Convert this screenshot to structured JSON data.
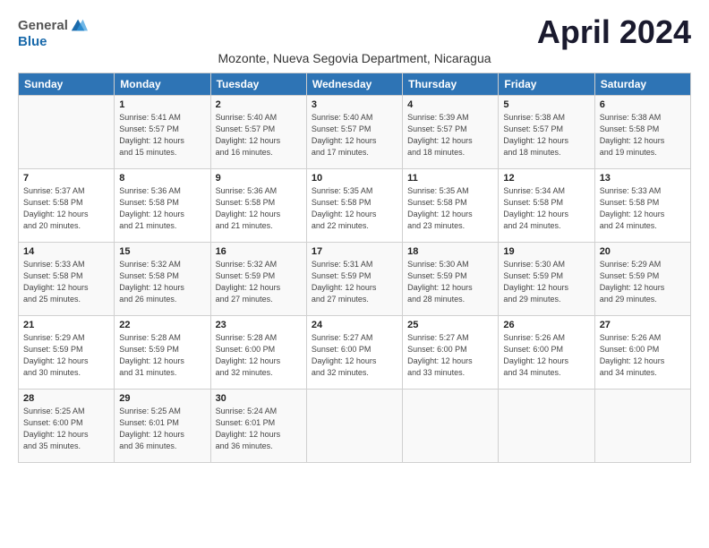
{
  "logo": {
    "general": "General",
    "blue": "Blue"
  },
  "title": "April 2024",
  "subtitle": "Mozonte, Nueva Segovia Department, Nicaragua",
  "weekdays": [
    "Sunday",
    "Monday",
    "Tuesday",
    "Wednesday",
    "Thursday",
    "Friday",
    "Saturday"
  ],
  "weeks": [
    [
      {
        "day": "",
        "info": ""
      },
      {
        "day": "1",
        "info": "Sunrise: 5:41 AM\nSunset: 5:57 PM\nDaylight: 12 hours\nand 15 minutes."
      },
      {
        "day": "2",
        "info": "Sunrise: 5:40 AM\nSunset: 5:57 PM\nDaylight: 12 hours\nand 16 minutes."
      },
      {
        "day": "3",
        "info": "Sunrise: 5:40 AM\nSunset: 5:57 PM\nDaylight: 12 hours\nand 17 minutes."
      },
      {
        "day": "4",
        "info": "Sunrise: 5:39 AM\nSunset: 5:57 PM\nDaylight: 12 hours\nand 18 minutes."
      },
      {
        "day": "5",
        "info": "Sunrise: 5:38 AM\nSunset: 5:57 PM\nDaylight: 12 hours\nand 18 minutes."
      },
      {
        "day": "6",
        "info": "Sunrise: 5:38 AM\nSunset: 5:58 PM\nDaylight: 12 hours\nand 19 minutes."
      }
    ],
    [
      {
        "day": "7",
        "info": "Sunrise: 5:37 AM\nSunset: 5:58 PM\nDaylight: 12 hours\nand 20 minutes."
      },
      {
        "day": "8",
        "info": "Sunrise: 5:36 AM\nSunset: 5:58 PM\nDaylight: 12 hours\nand 21 minutes."
      },
      {
        "day": "9",
        "info": "Sunrise: 5:36 AM\nSunset: 5:58 PM\nDaylight: 12 hours\nand 21 minutes."
      },
      {
        "day": "10",
        "info": "Sunrise: 5:35 AM\nSunset: 5:58 PM\nDaylight: 12 hours\nand 22 minutes."
      },
      {
        "day": "11",
        "info": "Sunrise: 5:35 AM\nSunset: 5:58 PM\nDaylight: 12 hours\nand 23 minutes."
      },
      {
        "day": "12",
        "info": "Sunrise: 5:34 AM\nSunset: 5:58 PM\nDaylight: 12 hours\nand 24 minutes."
      },
      {
        "day": "13",
        "info": "Sunrise: 5:33 AM\nSunset: 5:58 PM\nDaylight: 12 hours\nand 24 minutes."
      }
    ],
    [
      {
        "day": "14",
        "info": "Sunrise: 5:33 AM\nSunset: 5:58 PM\nDaylight: 12 hours\nand 25 minutes."
      },
      {
        "day": "15",
        "info": "Sunrise: 5:32 AM\nSunset: 5:58 PM\nDaylight: 12 hours\nand 26 minutes."
      },
      {
        "day": "16",
        "info": "Sunrise: 5:32 AM\nSunset: 5:59 PM\nDaylight: 12 hours\nand 27 minutes."
      },
      {
        "day": "17",
        "info": "Sunrise: 5:31 AM\nSunset: 5:59 PM\nDaylight: 12 hours\nand 27 minutes."
      },
      {
        "day": "18",
        "info": "Sunrise: 5:30 AM\nSunset: 5:59 PM\nDaylight: 12 hours\nand 28 minutes."
      },
      {
        "day": "19",
        "info": "Sunrise: 5:30 AM\nSunset: 5:59 PM\nDaylight: 12 hours\nand 29 minutes."
      },
      {
        "day": "20",
        "info": "Sunrise: 5:29 AM\nSunset: 5:59 PM\nDaylight: 12 hours\nand 29 minutes."
      }
    ],
    [
      {
        "day": "21",
        "info": "Sunrise: 5:29 AM\nSunset: 5:59 PM\nDaylight: 12 hours\nand 30 minutes."
      },
      {
        "day": "22",
        "info": "Sunrise: 5:28 AM\nSunset: 5:59 PM\nDaylight: 12 hours\nand 31 minutes."
      },
      {
        "day": "23",
        "info": "Sunrise: 5:28 AM\nSunset: 6:00 PM\nDaylight: 12 hours\nand 32 minutes."
      },
      {
        "day": "24",
        "info": "Sunrise: 5:27 AM\nSunset: 6:00 PM\nDaylight: 12 hours\nand 32 minutes."
      },
      {
        "day": "25",
        "info": "Sunrise: 5:27 AM\nSunset: 6:00 PM\nDaylight: 12 hours\nand 33 minutes."
      },
      {
        "day": "26",
        "info": "Sunrise: 5:26 AM\nSunset: 6:00 PM\nDaylight: 12 hours\nand 34 minutes."
      },
      {
        "day": "27",
        "info": "Sunrise: 5:26 AM\nSunset: 6:00 PM\nDaylight: 12 hours\nand 34 minutes."
      }
    ],
    [
      {
        "day": "28",
        "info": "Sunrise: 5:25 AM\nSunset: 6:00 PM\nDaylight: 12 hours\nand 35 minutes."
      },
      {
        "day": "29",
        "info": "Sunrise: 5:25 AM\nSunset: 6:01 PM\nDaylight: 12 hours\nand 36 minutes."
      },
      {
        "day": "30",
        "info": "Sunrise: 5:24 AM\nSunset: 6:01 PM\nDaylight: 12 hours\nand 36 minutes."
      },
      {
        "day": "",
        "info": ""
      },
      {
        "day": "",
        "info": ""
      },
      {
        "day": "",
        "info": ""
      },
      {
        "day": "",
        "info": ""
      }
    ]
  ]
}
